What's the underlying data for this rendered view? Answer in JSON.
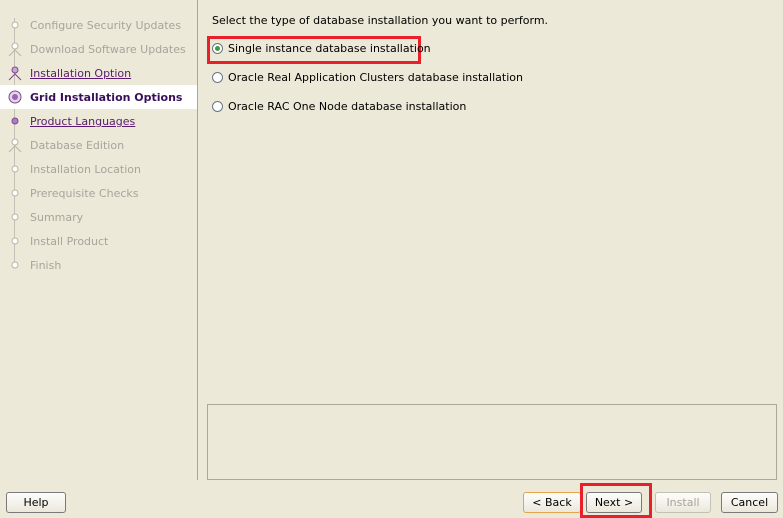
{
  "nav": {
    "steps": [
      {
        "label": "Configure Security Updates",
        "state": "disabled"
      },
      {
        "label": "Download Software Updates",
        "state": "disabled"
      },
      {
        "label": "Installation Option",
        "state": "link"
      },
      {
        "label": "Grid Installation Options",
        "state": "current"
      },
      {
        "label": "Product Languages",
        "state": "link"
      },
      {
        "label": "Database Edition",
        "state": "disabled"
      },
      {
        "label": "Installation Location",
        "state": "disabled"
      },
      {
        "label": "Prerequisite Checks",
        "state": "disabled"
      },
      {
        "label": "Summary",
        "state": "disabled"
      },
      {
        "label": "Install Product",
        "state": "disabled"
      },
      {
        "label": "Finish",
        "state": "disabled"
      }
    ]
  },
  "main": {
    "prompt": "Select the type of database installation you want to perform.",
    "options": [
      {
        "label": "Single instance database installation",
        "checked": true
      },
      {
        "label": "Oracle Real Application Clusters database installation",
        "checked": false
      },
      {
        "label": "Oracle RAC One Node database installation",
        "checked": false
      }
    ]
  },
  "buttons": {
    "help": "Help",
    "back": "< Back",
    "next": "Next >",
    "install": "Install",
    "cancel": "Cancel"
  },
  "colors": {
    "highlight": "#e8202a",
    "current_step_text": "#3a0f5a",
    "link_step_text": "#5a1a6e",
    "radio_selected": "#3f9b3f"
  }
}
